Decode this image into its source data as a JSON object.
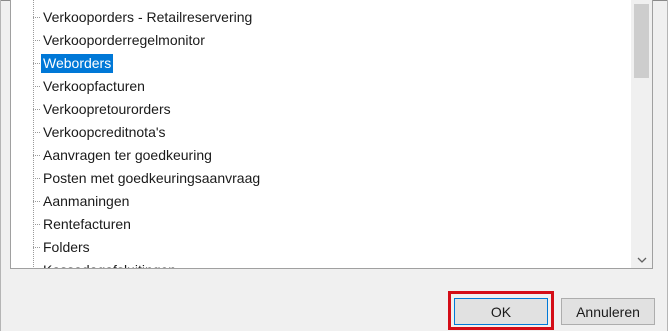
{
  "tree": {
    "items": [
      {
        "label": "Verkooporders - Retailreservering",
        "selected": false
      },
      {
        "label": "Verkooporderregelmonitor",
        "selected": false
      },
      {
        "label": "Weborders",
        "selected": true
      },
      {
        "label": "Verkoopfacturen",
        "selected": false
      },
      {
        "label": "Verkoopretourorders",
        "selected": false
      },
      {
        "label": "Verkoopcreditnota's",
        "selected": false
      },
      {
        "label": "Aanvragen ter goedkeuring",
        "selected": false
      },
      {
        "label": "Posten met goedkeuringsaanvraag",
        "selected": false
      },
      {
        "label": "Aanmaningen",
        "selected": false
      },
      {
        "label": "Rentefacturen",
        "selected": false
      },
      {
        "label": "Folders",
        "selected": false
      },
      {
        "label": "Kassadagafsluitingen",
        "selected": false,
        "partially_visible": true
      }
    ]
  },
  "buttons": {
    "ok_label": "OK",
    "cancel_label": "Annuleren"
  },
  "colors": {
    "selection": "#0078d7",
    "highlight_box": "#d40d17"
  },
  "icons": {
    "scroll_down": "chevron-down-icon"
  }
}
